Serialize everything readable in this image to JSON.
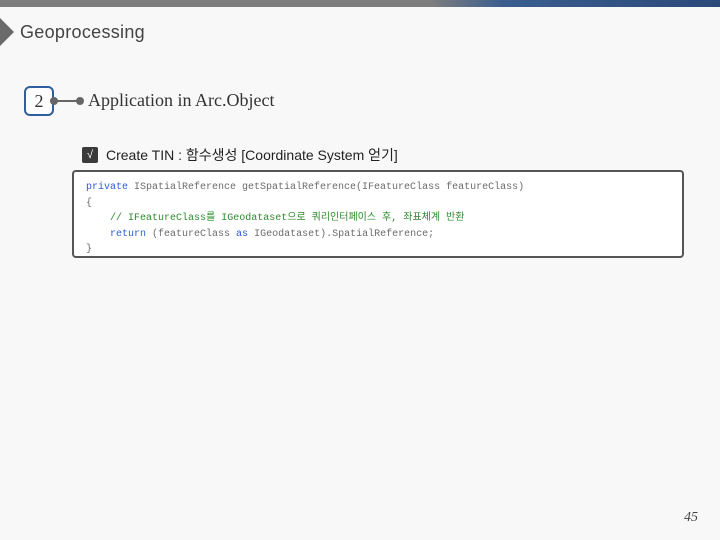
{
  "header": {
    "breadcrumb": "Geoprocessing"
  },
  "section": {
    "number": "2",
    "title": "Application in Arc.Object"
  },
  "sub": {
    "badge": "√",
    "label": "Create TIN : 함수생성 [Coordinate System 얻기]"
  },
  "code": {
    "l1a": "private",
    "l1b": " ISpatialReference getSpatialReference(IFeatureClass featureClass)",
    "l2": "{",
    "l3pad": "    ",
    "l3a": "// IFeatureClass를 IGeodataset으로 쿼리인터페이스 후, 좌표체계 반환",
    "l4pad": "    ",
    "l4a": "return",
    "l4b": " (featureClass ",
    "l4c": "as",
    "l4d": " IGeodataset).SpatialReference;",
    "l5": "}"
  },
  "page": "45"
}
